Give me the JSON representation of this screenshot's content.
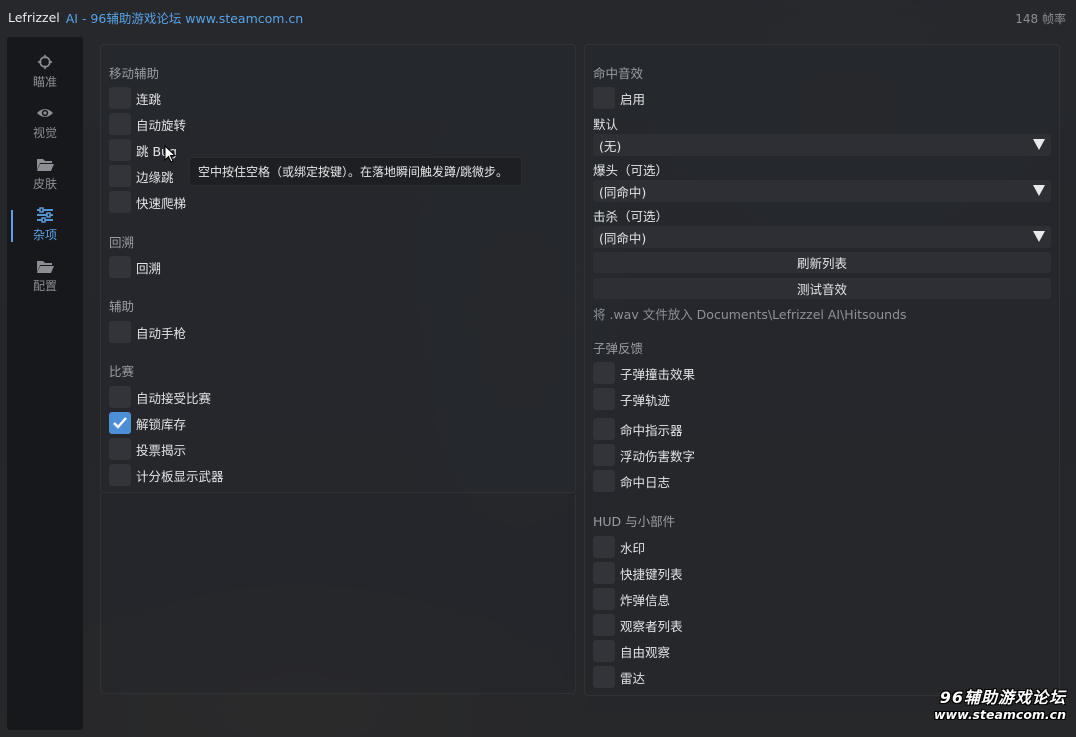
{
  "window": {
    "brand": "Lefrizzel",
    "title_rest": "AI - 96辅助游戏论坛 www.steamcom.cn",
    "fps": "148 帧率"
  },
  "sidebar": {
    "items": [
      {
        "label": "瞄准",
        "icon": "crosshair-icon"
      },
      {
        "label": "视觉",
        "icon": "eye-icon"
      },
      {
        "label": "皮肤",
        "icon": "folder-icon"
      },
      {
        "label": "杂项",
        "icon": "sliders-icon",
        "active": true
      },
      {
        "label": "配置",
        "icon": "folder-icon"
      }
    ]
  },
  "left": {
    "movement": {
      "title": "移动辅助",
      "items": [
        "连跳",
        "自动旋转",
        "跳 Bug",
        "边缘跳",
        "快速爬梯"
      ]
    },
    "backtrack": {
      "title": "回溯",
      "items": [
        "回溯"
      ]
    },
    "assist": {
      "title": "辅助",
      "items": [
        "自动手枪"
      ]
    },
    "match": {
      "title": "比赛",
      "items": [
        "自动接受比赛",
        "解锁库存",
        "投票揭示",
        "计分板显示武器"
      ],
      "checked_index": 1
    }
  },
  "tooltip": "空中按住空格（或绑定按键）。在落地瞬间触发蹲/跳微步。",
  "right": {
    "hitsound": {
      "title": "命中音效",
      "enable": "启用",
      "default_label": "默认",
      "default_value": "(无)",
      "headshot_label": "爆头（可选）",
      "headshot_value": "(同命中)",
      "kill_label": "击杀（可选）",
      "kill_value": "(同命中)",
      "refresh": "刷新列表",
      "test": "测试音效",
      "hint": "将 .wav 文件放入 Documents\\Lefrizzel AI\\Hitsounds"
    },
    "bullet": {
      "title": "子弹反馈",
      "items": [
        "子弹撞击效果",
        "子弹轨迹",
        "命中指示器",
        "浮动伤害数字",
        "命中日志"
      ]
    },
    "hud": {
      "title": "HUD 与小部件",
      "items": [
        "水印",
        "快捷键列表",
        "炸弹信息",
        "观察者列表",
        "自由观察",
        "雷达"
      ]
    }
  },
  "watermark": {
    "cn": "96辅助游戏论坛",
    "url": "www.steamcom.cn"
  },
  "colors": {
    "accent": "#5aa3e6",
    "checked": "#4c8fd6",
    "panel": "#26282d"
  }
}
